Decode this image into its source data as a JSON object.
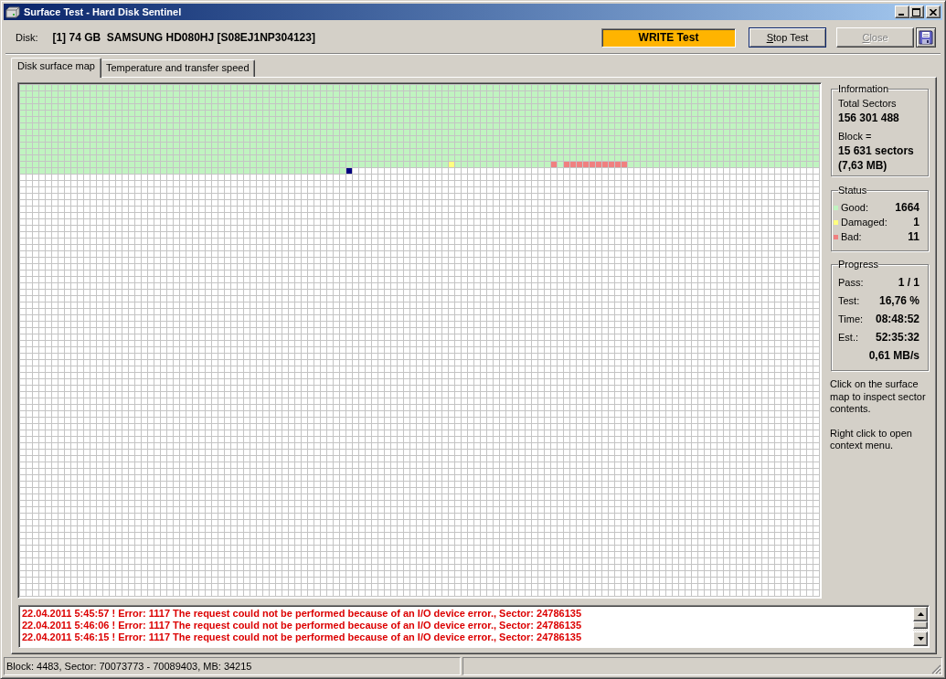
{
  "window": {
    "title": "Surface Test - Hard Disk Sentinel"
  },
  "disk": {
    "label": "Disk:",
    "value": "[1] 74 GB  SAMSUNG HD080HJ [S08EJ1NP304123]"
  },
  "test_mode": {
    "text": "WRITE Test"
  },
  "buttons": [
    {
      "label": "Stop Test",
      "mnemonic": true,
      "default": true,
      "disabled": false
    },
    {
      "label": "Close",
      "mnemonic": true,
      "default": false,
      "disabled": true
    }
  ],
  "tabs": [
    {
      "label": "Disk surface map",
      "selected": true
    },
    {
      "label": "Temperature and transfer speed",
      "selected": false
    }
  ],
  "information": {
    "title": "Information",
    "items": [
      {
        "kind": "label",
        "text": "Total Sectors"
      },
      {
        "kind": "value",
        "text": "156 301 488"
      },
      {
        "kind": "label",
        "text": "Block ="
      },
      {
        "kind": "value",
        "text": "15 631 sectors"
      },
      {
        "kind": "value",
        "text": "(7,63 MB)"
      }
    ]
  },
  "status": {
    "title": "Status",
    "items": [
      {
        "kind": "good",
        "label": "Good:",
        "value": "1664",
        "color": "#c0f4c0"
      },
      {
        "kind": "damaged",
        "label": "Damaged:",
        "value": "1",
        "color": "#ffff80"
      },
      {
        "kind": "bad",
        "label": "Bad:",
        "value": "11",
        "color": "#f08080"
      }
    ]
  },
  "progress": {
    "title": "Progress",
    "items": [
      {
        "label": "Pass:",
        "value": "1 / 1"
      },
      {
        "label": "Test:",
        "value": "16,76 %"
      },
      {
        "label": "Time:",
        "value": "08:48:52"
      },
      {
        "label": "Est.:",
        "value": "52:35:32"
      },
      {
        "value": "0,61 MB/s"
      }
    ]
  },
  "help": [
    "Click on the surface map to inspect sector contents.",
    "Right click to open context menu."
  ],
  "log": [
    "22.04.2011 5:45:57 ! Error: 1117 The request could not be performed because of an I/O device error., Sector: 24786135",
    "22.04.2011 5:46:06 ! Error: 1117 The request could not be performed because of an I/O device error., Sector: 24786135",
    "22.04.2011 5:46:15 ! Error: 1117 The request could not be performed because of an I/O device error., Sector: 24786135"
  ],
  "status_bar": {
    "text": "Block: 4483, Sector: 70073773 - 70089403, MB: 34215"
  }
}
